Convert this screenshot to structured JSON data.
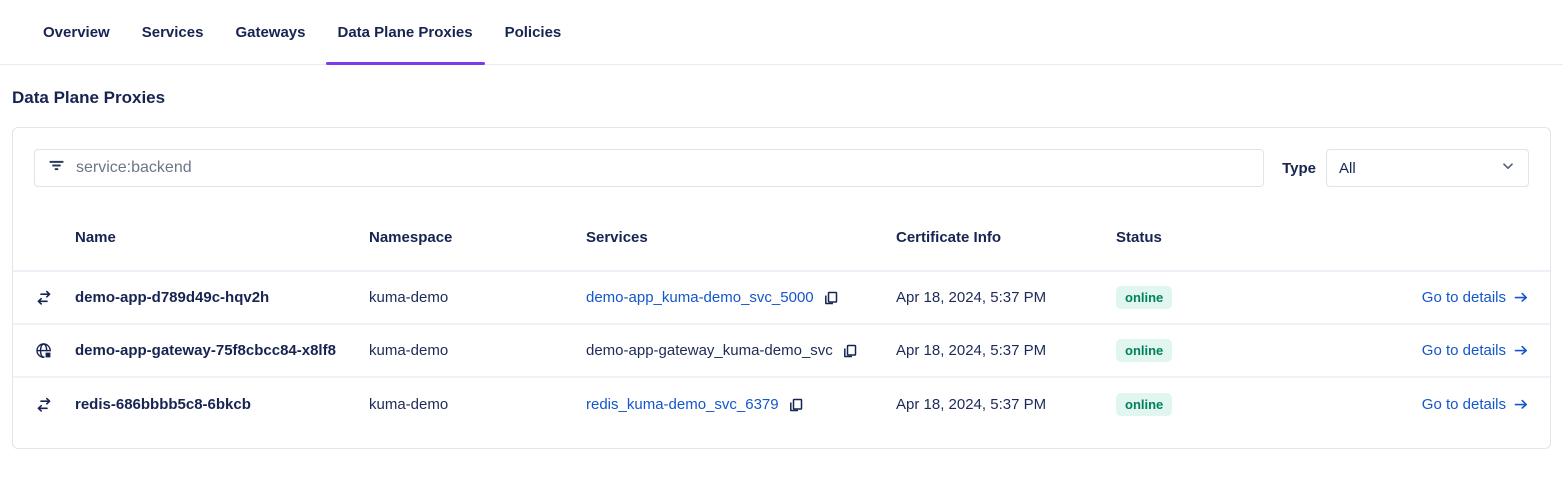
{
  "tabs": {
    "items": [
      {
        "label": "Overview",
        "active": false
      },
      {
        "label": "Services",
        "active": false
      },
      {
        "label": "Gateways",
        "active": false
      },
      {
        "label": "Data Plane Proxies",
        "active": true
      },
      {
        "label": "Policies",
        "active": false
      }
    ]
  },
  "page": {
    "title": "Data Plane Proxies"
  },
  "filters": {
    "search": {
      "placeholder": "service:backend",
      "icon": "filter-icon"
    },
    "type": {
      "label": "Type",
      "selected": "All",
      "icon": "chevron-down-icon"
    }
  },
  "table": {
    "columns": [
      "Name",
      "Namespace",
      "Services",
      "Certificate Info",
      "Status"
    ],
    "details_label": "Go to details",
    "rows": [
      {
        "type_icon": "standard-proxy-icon",
        "name": "demo-app-d789d49c-hqv2h",
        "namespace": "kuma-demo",
        "service": "demo-app_kuma-demo_svc_5000",
        "service_is_link": true,
        "certificate": "Apr 18, 2024, 5:37 PM",
        "status": "online"
      },
      {
        "type_icon": "gateway-icon",
        "name": "demo-app-gateway-75f8cbcc84-x8lf8",
        "namespace": "kuma-demo",
        "service": "demo-app-gateway_kuma-demo_svc",
        "service_is_link": false,
        "certificate": "Apr 18, 2024, 5:37 PM",
        "status": "online"
      },
      {
        "type_icon": "standard-proxy-icon",
        "name": "redis-686bbbb5c8-6bkcb",
        "namespace": "kuma-demo",
        "service": "redis_kuma-demo_svc_6379",
        "service_is_link": true,
        "certificate": "Apr 18, 2024, 5:37 PM",
        "status": "online"
      }
    ]
  },
  "colors": {
    "accent_purple": "#7c3aed",
    "link_blue": "#1456cb",
    "navy_text": "#172452",
    "status_online_bg": "#e1f6ee",
    "status_online_text": "#00805f"
  }
}
